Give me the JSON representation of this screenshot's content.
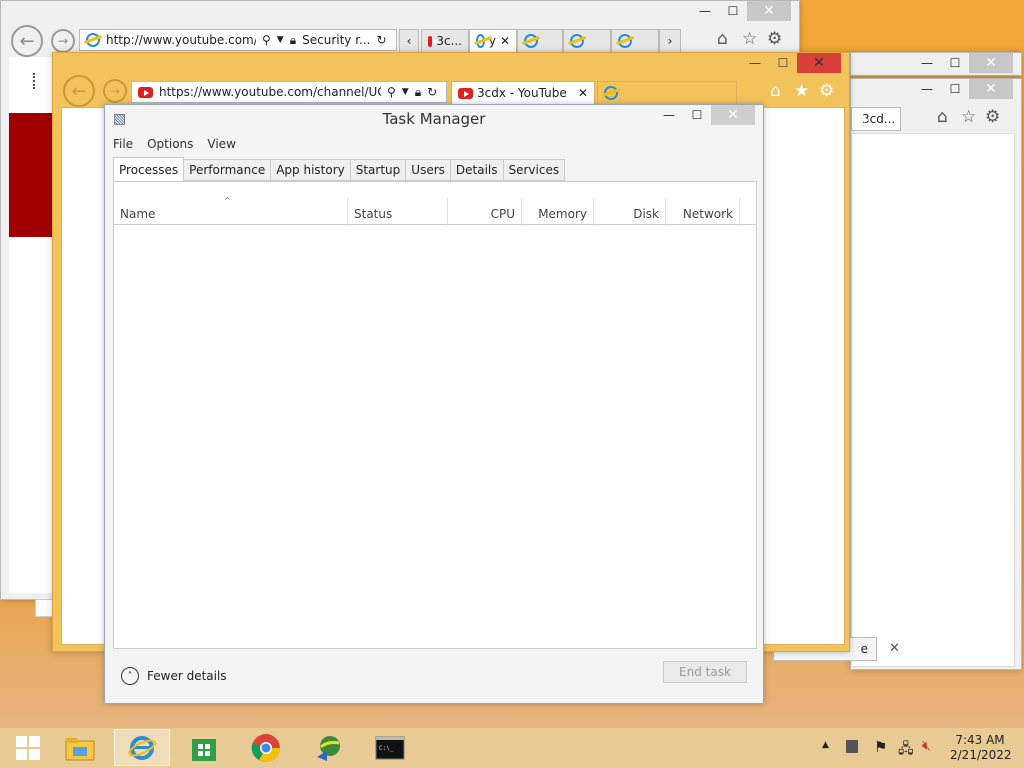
{
  "ie_back": {
    "url": "http://www.youtube.com/c",
    "security": "Security r...",
    "tab_short": "3c...",
    "tab2_short": "y"
  },
  "ie_right": {
    "tab_short": "3cd...",
    "button_short": "e"
  },
  "ie_front": {
    "url": "https://www.youtube.com/channel/UCm",
    "tab_title": "3cdx - YouTube"
  },
  "task_manager": {
    "title": "Task Manager",
    "menu": [
      "File",
      "Options",
      "View"
    ],
    "tabs": [
      "Processes",
      "Performance",
      "App history",
      "Startup",
      "Users",
      "Details",
      "Services"
    ],
    "active_tab": "Processes",
    "columns": [
      "Name",
      "Status",
      "CPU",
      "Memory",
      "Disk",
      "Network"
    ],
    "fewer_details": "Fewer details",
    "end_task": "End task"
  },
  "taskbar": {
    "apps": [
      "start-icon",
      "file-explorer-icon",
      "internet-explorer-icon",
      "store-icon",
      "chrome-icon",
      "network-globe-icon",
      "command-prompt-icon"
    ],
    "active_app": "internet-explorer-icon"
  },
  "tray": {
    "time": "7:43 AM",
    "date": "2/21/2022"
  },
  "colors": {
    "desktop": "#f0a02c",
    "ie_frame": "#f3c35b",
    "close_red": "#d9403a",
    "dark_red_block": "#a00000"
  }
}
